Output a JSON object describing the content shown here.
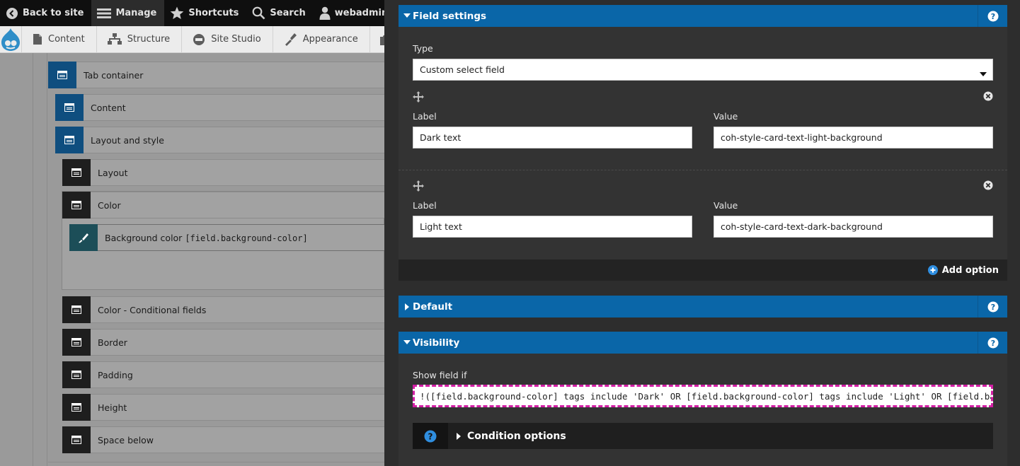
{
  "toolbar": {
    "back_to_site": "Back to site",
    "manage": "Manage",
    "shortcuts": "Shortcuts",
    "search": "Search",
    "user": "webadmin"
  },
  "tray": {
    "items": [
      "Content",
      "Structure",
      "Site Studio",
      "Appearance"
    ]
  },
  "builder": {
    "tab_container": "Tab container",
    "content": "Content",
    "layout_and_style": "Layout and style",
    "layout": "Layout",
    "color": "Color",
    "background_color_label": "Background color",
    "background_color_token": "[field.background-color]",
    "color_conditional": "Color - Conditional fields",
    "border": "Border",
    "padding": "Padding",
    "height": "Height",
    "space_below": "Space below"
  },
  "field_settings": {
    "title": "Field settings",
    "type_label": "Type",
    "type_value": "Custom select field",
    "options": [
      {
        "label_caption": "Label",
        "label": "Dark text",
        "value_caption": "Value",
        "value": "coh-style-card-text-light-background"
      },
      {
        "label_caption": "Label",
        "label": "Light text",
        "value_caption": "Value",
        "value": "coh-style-card-text-dark-background"
      }
    ],
    "add_option": "Add option"
  },
  "default_section": {
    "title": "Default"
  },
  "visibility": {
    "title": "Visibility",
    "show_field_if_label": "Show field if",
    "show_field_if_value": "!([field.background-color] tags include 'Dark' OR [field.background-color] tags include 'Light' OR [field.background-color]",
    "condition_options": "Condition options"
  },
  "colors": {
    "header_blue": "#0a66a8",
    "panel_bg": "#2d2d2d",
    "highlight": "#d21ea4"
  }
}
